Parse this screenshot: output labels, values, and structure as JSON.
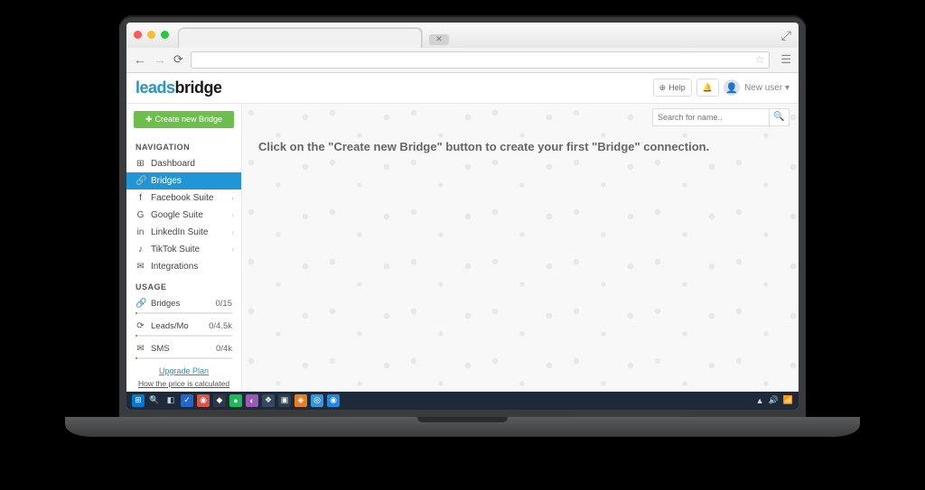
{
  "brand": {
    "part1": "leads",
    "part2": "bridge"
  },
  "header": {
    "help_label": "Help",
    "user_label": "New user",
    "dropdown_caret": "▾"
  },
  "sidebar": {
    "create_label": "Create new Bridge",
    "nav_title": "NAVIGATION",
    "items": [
      {
        "icon": "⊞",
        "label": "Dashboard",
        "chev": false
      },
      {
        "icon": "🔗",
        "label": "Bridges",
        "chev": false,
        "active": true
      },
      {
        "icon": "f",
        "label": "Facebook Suite",
        "chev": true
      },
      {
        "icon": "G",
        "label": "Google Suite",
        "chev": true
      },
      {
        "icon": "in",
        "label": "LinkedIn Suite",
        "chev": true
      },
      {
        "icon": "♪",
        "label": "TikTok Suite",
        "chev": true
      },
      {
        "icon": "✉",
        "label": "Integrations",
        "chev": false
      }
    ],
    "usage_title": "USAGE",
    "usage": [
      {
        "icon": "🔗",
        "label": "Bridges",
        "value": "0/15"
      },
      {
        "icon": "⟳",
        "label": "Leads/Mo",
        "value": "0/4.5k"
      },
      {
        "icon": "✉",
        "label": "SMS",
        "value": "0/4k"
      }
    ],
    "upgrade": "Upgrade Plan",
    "price_info": "How the price is calculated"
  },
  "main": {
    "search_placeholder": "Search for name..",
    "empty_message": "Click on the \"Create new Bridge\" button to create your first \"Bridge\" connection."
  },
  "taskbar": {
    "tray": [
      "▲",
      "🔊",
      "📶"
    ]
  }
}
